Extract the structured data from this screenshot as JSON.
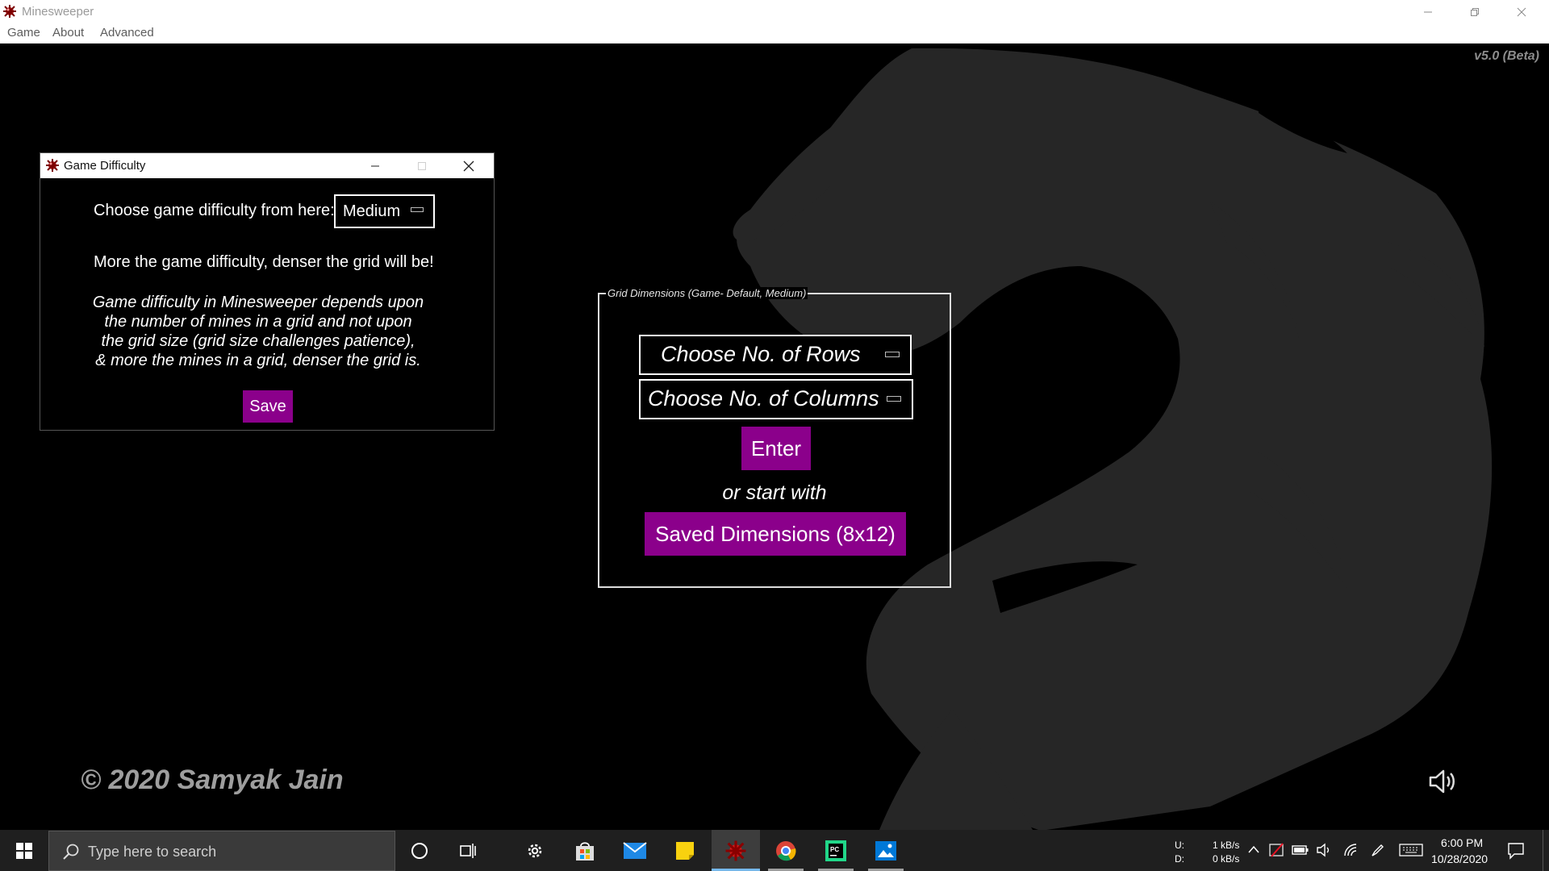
{
  "window": {
    "title": "Minesweeper",
    "menu": [
      "Game",
      "About",
      "Advanced"
    ],
    "version": "v5.0 (Beta)",
    "copyright": "© 2020 Samyak Jain"
  },
  "grid_panel": {
    "legend": "Grid Dimensions (Game- Default, Medium)",
    "rows_placeholder": "Choose No. of Rows",
    "columns_placeholder": "Choose No. of Columns",
    "enter_label": "Enter",
    "or_text": "or start with",
    "saved_label": "Saved Dimensions (8x12)"
  },
  "difficulty_dialog": {
    "title": "Game Difficulty",
    "prompt": "Choose game difficulty from here:",
    "selected": "Medium",
    "info": "More the game difficulty, denser the grid will be!",
    "description_lines": [
      "Game difficulty in Minesweeper depends upon",
      "the number of mines in a grid and not upon",
      "the grid size (grid size challenges patience),",
      "& more the mines in a grid, denser the grid is."
    ],
    "save_label": "Save"
  },
  "taskbar": {
    "search_placeholder": "Type here to search",
    "net_upload_label": "U:",
    "net_download_label": "D:",
    "net_upload": "1 kB/s",
    "net_download": "0 kB/s",
    "time": "6:00 PM",
    "date": "10/28/2020"
  },
  "colors": {
    "accent_purple": "#8b008b",
    "background": "#000000",
    "dragon_gray": "#2a2a2a",
    "taskbar": "#1f1f1f"
  },
  "icons": {
    "app": "minesweeper-mine-icon",
    "speaker": "speaker-icon"
  }
}
